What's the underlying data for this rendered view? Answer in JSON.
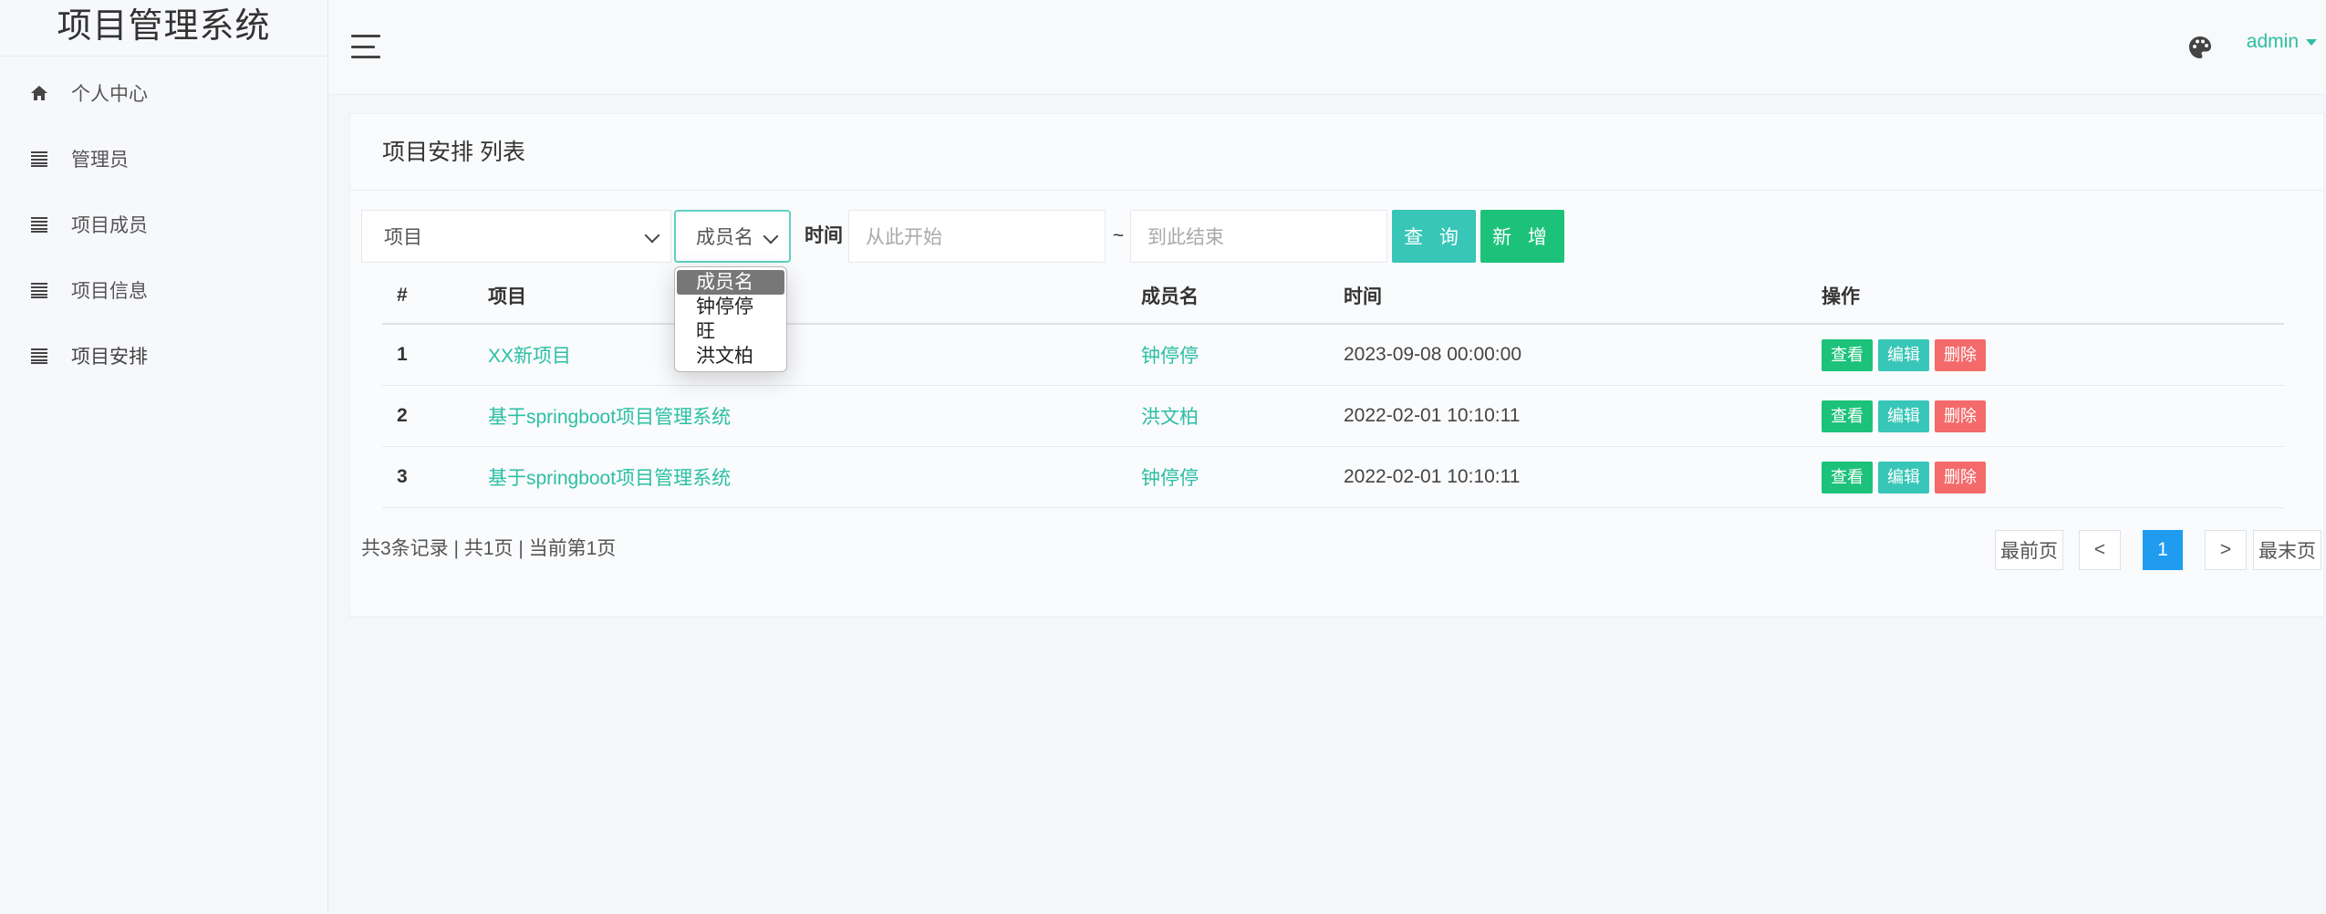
{
  "sidebar": {
    "brand": "项目管理系统",
    "items": [
      {
        "label": "个人中心",
        "icon": "home-icon"
      },
      {
        "label": "管理员",
        "icon": "list-icon"
      },
      {
        "label": "项目成员",
        "icon": "list-icon"
      },
      {
        "label": "项目信息",
        "icon": "list-icon"
      },
      {
        "label": "项目安排",
        "icon": "list-icon"
      }
    ]
  },
  "header": {
    "user": "admin",
    "icons": [
      "menu-icon",
      "palette-icon",
      "caret-down-icon"
    ]
  },
  "card": {
    "title": "项目安排 列表"
  },
  "filters": {
    "project_select": "项目",
    "member_select": "成员名",
    "time_label": "时间",
    "start_placeholder": "从此开始",
    "tilde": "~",
    "end_placeholder": "到此结束",
    "search_label": "查 询",
    "add_label": "新 增"
  },
  "dropdown": {
    "options": [
      "成员名",
      "钟停停",
      "旺",
      "洪文柏"
    ],
    "selected": "成员名"
  },
  "table": {
    "headers": [
      "#",
      "项目",
      "成员名",
      "时间",
      "操作"
    ],
    "rows": [
      {
        "idx": "1",
        "project": "XX新项目",
        "member": "钟停停",
        "time": "2023-09-08 00:00:00"
      },
      {
        "idx": "2",
        "project": "基于springboot项目管理系统",
        "member": "洪文柏",
        "time": "2022-02-01 10:10:11"
      },
      {
        "idx": "3",
        "project": "基于springboot项目管理系统",
        "member": "钟停停",
        "time": "2022-02-01 10:10:11"
      }
    ],
    "actions": {
      "view": "查看",
      "edit": "编辑",
      "delete": "删除"
    }
  },
  "footer": {
    "summary": "共3条记录 | 共1页 | 当前第1页",
    "first": "最前页",
    "prev": "<",
    "current": "1",
    "next": ">",
    "last": "最末页"
  },
  "colors": {
    "accent": "#2bbfa3",
    "search_button": "#37c6b7",
    "add_button": "#1cc27a",
    "delete_button": "#f46a6a",
    "pager_active": "#1f9cf0"
  }
}
